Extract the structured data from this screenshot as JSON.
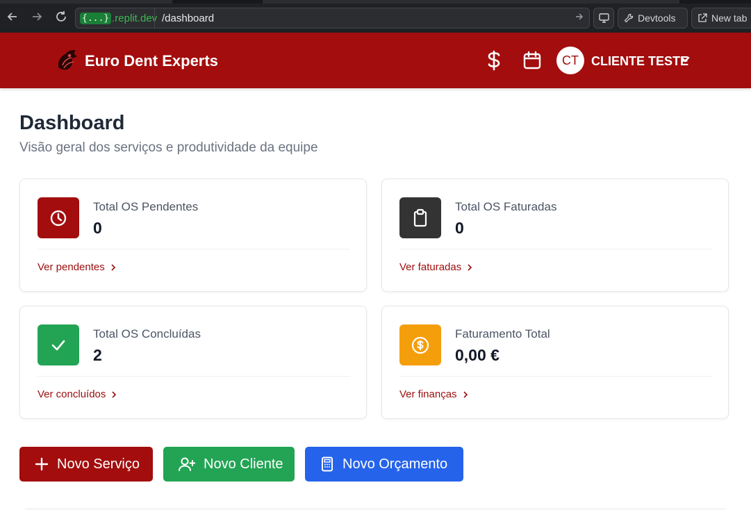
{
  "browser": {
    "url_domain_badge": "{...}",
    "url_domain": ".replit.dev",
    "url_path": "/dashboard",
    "devtools_label": "Devtools",
    "newtab_label": "New tab"
  },
  "header": {
    "brand_title": "Euro Dent Experts",
    "user_initials": "CT",
    "user_name": "CLIENTE TESTE",
    "icons": [
      "dollar-icon",
      "calendar-icon",
      "chevron-down-icon"
    ]
  },
  "page": {
    "title": "Dashboard",
    "subtitle": "Visão geral dos serviços e produtividade da equipe"
  },
  "cards": [
    {
      "label": "Total OS Pendentes",
      "value": "0",
      "link": "Ver pendentes",
      "icon": "clock-icon",
      "color": "#a30d0d"
    },
    {
      "label": "Total OS Faturadas",
      "value": "0",
      "link": "Ver faturadas",
      "icon": "clipboard-icon",
      "color": "#333333"
    },
    {
      "label": "Total OS Concluídas",
      "value": "2",
      "link": "Ver concluídos",
      "icon": "check-icon",
      "color": "#22a454"
    },
    {
      "label": "Faturamento Total",
      "value": "0,00 €",
      "link": "Ver finanças",
      "icon": "dollar-circle-icon",
      "color": "#f59e0b"
    }
  ],
  "actions": [
    {
      "label": "Novo Serviço",
      "icon": "plus-icon",
      "color": "#a30d0d"
    },
    {
      "label": "Novo Cliente",
      "icon": "user-plus-icon",
      "color": "#22a454"
    },
    {
      "label": "Novo Orçamento",
      "icon": "calculator-icon",
      "color": "#2563eb"
    }
  ],
  "colors": {
    "brand": "#a30d0d",
    "link": "#9b0d0d"
  }
}
